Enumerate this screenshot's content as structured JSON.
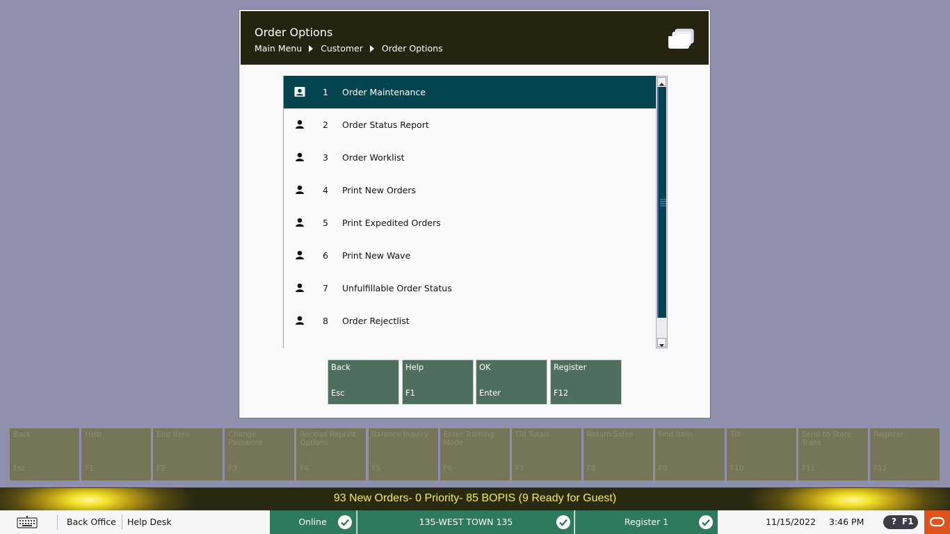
{
  "dialog": {
    "title": "Order Options",
    "breadcrumb": [
      "Main Menu",
      "Customer",
      "Order Options"
    ],
    "header_icon": "folders-icon"
  },
  "menu": {
    "selected_index": 0,
    "items": [
      {
        "num": "1",
        "label": "Order Maintenance",
        "icon": "user-card-icon"
      },
      {
        "num": "2",
        "label": "Order Status Report",
        "icon": "user-icon"
      },
      {
        "num": "3",
        "label": "Order Worklist",
        "icon": "user-icon"
      },
      {
        "num": "4",
        "label": "Print New Orders",
        "icon": "user-icon"
      },
      {
        "num": "5",
        "label": "Print Expedited Orders",
        "icon": "user-icon"
      },
      {
        "num": "6",
        "label": "Print New Wave",
        "icon": "user-icon"
      },
      {
        "num": "7",
        "label": "Unfulfillable Order Status",
        "icon": "user-icon"
      },
      {
        "num": "8",
        "label": "Order Rejectlist",
        "icon": "user-icon"
      }
    ]
  },
  "dialog_buttons": [
    {
      "label": "Back",
      "key": "Esc"
    },
    {
      "label": "Help",
      "key": "F1"
    },
    {
      "label": "OK",
      "key": "Enter"
    },
    {
      "label": "Register",
      "key": "F12"
    }
  ],
  "function_keys": [
    {
      "label": "Back",
      "key": "Esc"
    },
    {
      "label": "Help",
      "key": "F1"
    },
    {
      "label": "End Item",
      "key": "F2"
    },
    {
      "label": "Change Password",
      "key": "F3"
    },
    {
      "label": "Receipt Reprint Options",
      "key": "F4"
    },
    {
      "label": "Balance Inquiry",
      "key": "F5"
    },
    {
      "label": "Enter Training Mode",
      "key": "F6"
    },
    {
      "label": "Tilt Totals",
      "key": "F7"
    },
    {
      "label": "Return Sales",
      "key": "F8"
    },
    {
      "label": "Find Item",
      "key": "F9"
    },
    {
      "label": "Till",
      "key": "F10"
    },
    {
      "label": "Send to Store Trans",
      "key": "F11"
    },
    {
      "label": "Register",
      "key": "F12"
    }
  ],
  "notification": "93 New Orders- 0 Priority- 85 BOPIS (9 Ready for Guest)",
  "statusbar": {
    "back_office": "Back Office",
    "help_desk": "Help Desk",
    "online": "Online",
    "store": "135-WEST TOWN 135",
    "register": "Register 1",
    "date": "11/15/2022",
    "time": "3:46 PM",
    "help_q": "?",
    "help_key": "F1"
  },
  "colors": {
    "selected_row": "#05454f",
    "header_bg": "#262410",
    "status_green": "#2d7a5c",
    "notif_text": "#f2ee4a",
    "oracle_orange": "#e0531a"
  }
}
